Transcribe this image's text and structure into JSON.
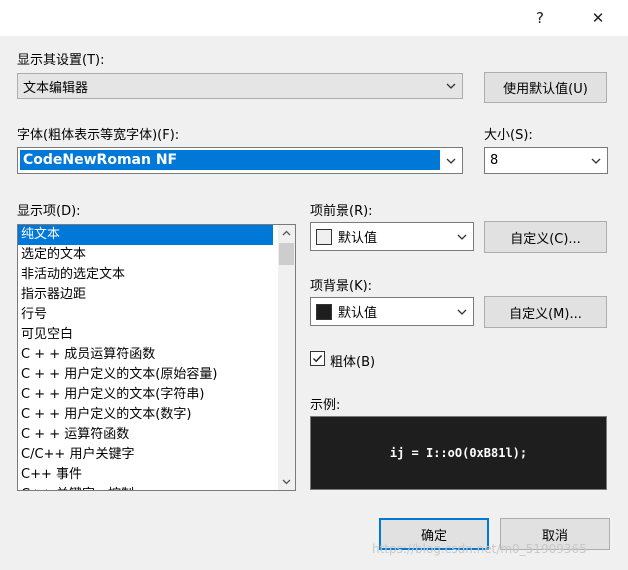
{
  "title_bar": {
    "help_label": "?",
    "close_label": "✕"
  },
  "display_settings": {
    "label": "显示其设置(T):",
    "selected": "文本编辑器",
    "use_defaults_button": "使用默认值(U)"
  },
  "font": {
    "label": "字体(粗体表示等宽字体)(F):",
    "selected": "CodeNewRoman NF"
  },
  "size": {
    "label": "大小(S):",
    "selected": "8"
  },
  "display_items": {
    "label": "显示项(D):",
    "items": [
      "纯文本",
      "选定的文本",
      "非活动的选定文本",
      "指示器边距",
      "行号",
      "可见空白",
      "C + + 成员运算符函数",
      "C + + 用户定义的文本(原始容量)",
      "C + + 用户定义的文本(字符串)",
      "C + + 用户定义的文本(数字)",
      "C + + 运算符函数",
      "C/C++ 用户关键字",
      "C++ 事件",
      "C++ 关键字 - 控制"
    ],
    "selected_index": 0
  },
  "foreground": {
    "label": "项前景(R):",
    "selected": "默认值",
    "swatch_color": "#f0f0f0",
    "custom_button": "自定义(C)..."
  },
  "background": {
    "label": "项背景(K):",
    "selected": "默认值",
    "swatch_color": "#1e1e1e",
    "custom_button": "自定义(M)..."
  },
  "bold": {
    "label": "粗体(B)",
    "checked": true
  },
  "sample": {
    "label": "示例:",
    "text": "ij = I::oO(0xB81l);",
    "background_color": "#1e1e1e",
    "text_color": "#ffffff"
  },
  "footer": {
    "ok_button": "确定",
    "cancel_button": "取消",
    "watermark": "https://blog.csdn.net/m0_51909365"
  },
  "colors": {
    "accent": "#0078d7",
    "dialog_bg": "#f0f0f0"
  }
}
